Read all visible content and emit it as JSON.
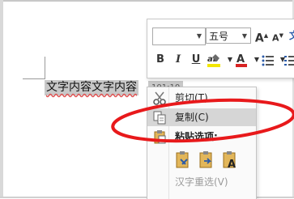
{
  "colors": {
    "selection": "#c8c8c8",
    "annotation_ellipse": "#e8191b",
    "menu_hover": "#d6d6d6",
    "highlight_yellow": "#f2e600",
    "font_color_red": "#d82323"
  },
  "document": {
    "selected_text": "文字内容文字内容",
    "selected_extra": "101:10"
  },
  "mini_toolbar": {
    "font_name_value": "",
    "font_size_value": "五号",
    "grow_font_label": "A",
    "shrink_font_label": "A",
    "format_painter_label": "文",
    "bold_label": "B",
    "italic_label": "I",
    "underline_label": "U",
    "highlight_label": "ab",
    "font_color_label": "A",
    "icons": [
      "chevron-down-icon",
      "highlighter-icon",
      "font-color-icon",
      "bullets-icon",
      "numbering-icon"
    ]
  },
  "context_menu": {
    "cut_label": "剪切(T)",
    "copy_label": "复制(C)",
    "paste_options_label": "粘贴选项:",
    "reconvert_label": "汉字重选(V)",
    "icons": [
      "scissors-icon",
      "copy-icon",
      "paste-icon",
      "paste-keep-formatting-icon",
      "paste-merge-formatting-icon",
      "paste-text-only-icon"
    ],
    "paste_text_only_glyph": "A"
  }
}
